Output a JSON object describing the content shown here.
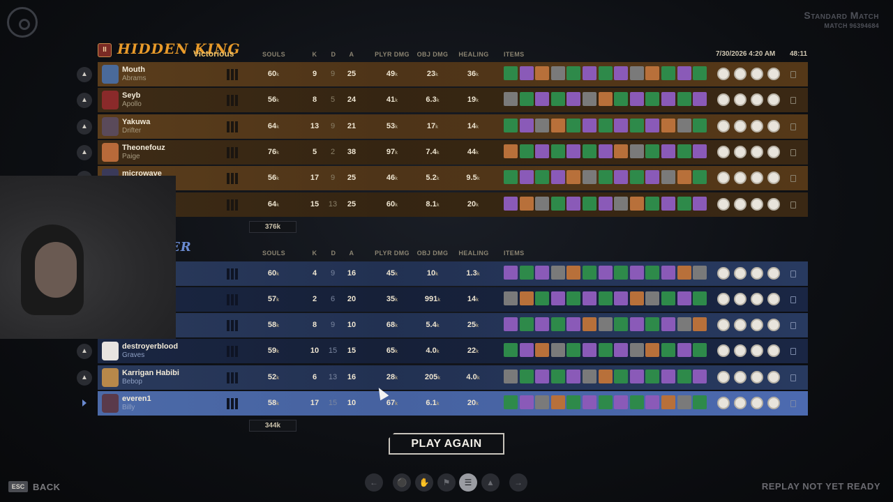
{
  "match": {
    "title": "Standard Match",
    "id": "MATCH 96394684"
  },
  "columns": {
    "souls": "SOULS",
    "k": "K",
    "d": "D",
    "a": "A",
    "plyr_dmg": "PLYR DMG",
    "obj_dmg": "OBJ DMG",
    "healing": "HEALING",
    "items": "ITEMS"
  },
  "date": "7/30/2026 4:20 AM",
  "duration": "48:11",
  "team1": {
    "name": "HIDDEN KING",
    "status": "Victorious",
    "total_souls": "376k",
    "players": [
      {
        "name": "Mouth",
        "hero": "Abrams",
        "souls": "60",
        "k": "9",
        "d": "9",
        "a": "25",
        "plyr": "49",
        "obj": "23",
        "heal": "36",
        "avatar_color": "#4a6a9a"
      },
      {
        "name": "Seyb",
        "hero": "Apollo",
        "souls": "56",
        "k": "8",
        "d": "5",
        "a": "24",
        "plyr": "41",
        "obj": "6.3",
        "heal": "19",
        "avatar_color": "#8a2a2a"
      },
      {
        "name": "Yakuwa",
        "hero": "Drifter",
        "souls": "64",
        "k": "13",
        "d": "9",
        "a": "21",
        "plyr": "53",
        "obj": "17",
        "heal": "14",
        "avatar_color": "#5a4a5a"
      },
      {
        "name": "Theonefouz",
        "hero": "Paige",
        "souls": "76",
        "k": "5",
        "d": "2",
        "a": "38",
        "plyr": "97",
        "obj": "7.4",
        "heal": "44",
        "avatar_color": "#b86a3a"
      },
      {
        "name": "microwave",
        "hero": "",
        "souls": "56",
        "k": "17",
        "d": "9",
        "a": "25",
        "plyr": "46",
        "obj": "5.2",
        "heal": "9.5",
        "avatar_color": "#3a3a5a"
      },
      {
        "name": "",
        "hero": "",
        "souls": "64",
        "k": "15",
        "d": "13",
        "a": "25",
        "plyr": "60",
        "obj": "8.1",
        "heal": "20",
        "avatar_color": "#3a3a3a"
      }
    ]
  },
  "team2": {
    "name": "ER",
    "total_souls": "344k",
    "players": [
      {
        "name": "",
        "hero": "",
        "souls": "60",
        "k": "4",
        "d": "9",
        "a": "16",
        "plyr": "45",
        "obj": "10",
        "heal": "1.3",
        "avatar_color": "#2a3a5a"
      },
      {
        "name": "",
        "hero": "",
        "souls": "57",
        "k": "2",
        "d": "6",
        "a": "20",
        "plyr": "35",
        "obj": "991",
        "heal": "14",
        "avatar_color": "#2a3a5a"
      },
      {
        "name": "",
        "hero": "",
        "souls": "58",
        "k": "8",
        "d": "9",
        "a": "10",
        "plyr": "68",
        "obj": "5.4",
        "heal": "25",
        "avatar_color": "#2a3a5a"
      },
      {
        "name": "destroyerblood",
        "hero": "Graves",
        "souls": "59",
        "k": "10",
        "d": "15",
        "a": "15",
        "plyr": "65",
        "obj": "4.0",
        "heal": "22",
        "avatar_color": "#e8e4e0"
      },
      {
        "name": "Karrigan Habibi",
        "hero": "Bebop",
        "souls": "52",
        "k": "6",
        "d": "13",
        "a": "16",
        "plyr": "28",
        "obj": "205",
        "heal": "4.0",
        "avatar_color": "#b8884a"
      },
      {
        "name": "everen1",
        "hero": "Billy",
        "souls": "58",
        "k": "17",
        "d": "15",
        "a": "10",
        "plyr": "67",
        "obj": "6.1",
        "heal": "20",
        "avatar_color": "#5a3a4a"
      }
    ]
  },
  "k_suffix": "k",
  "play_again": "PLAY AGAIN",
  "esc": "ESC",
  "back": "BACK",
  "replay": "REPLAY NOT YET READY",
  "colors": {
    "amber_row": "#5a3d1c",
    "blue_row": "#2a3a5c",
    "highlight_row": "#4c6aa8",
    "team1_accent": "#e89a2a"
  }
}
